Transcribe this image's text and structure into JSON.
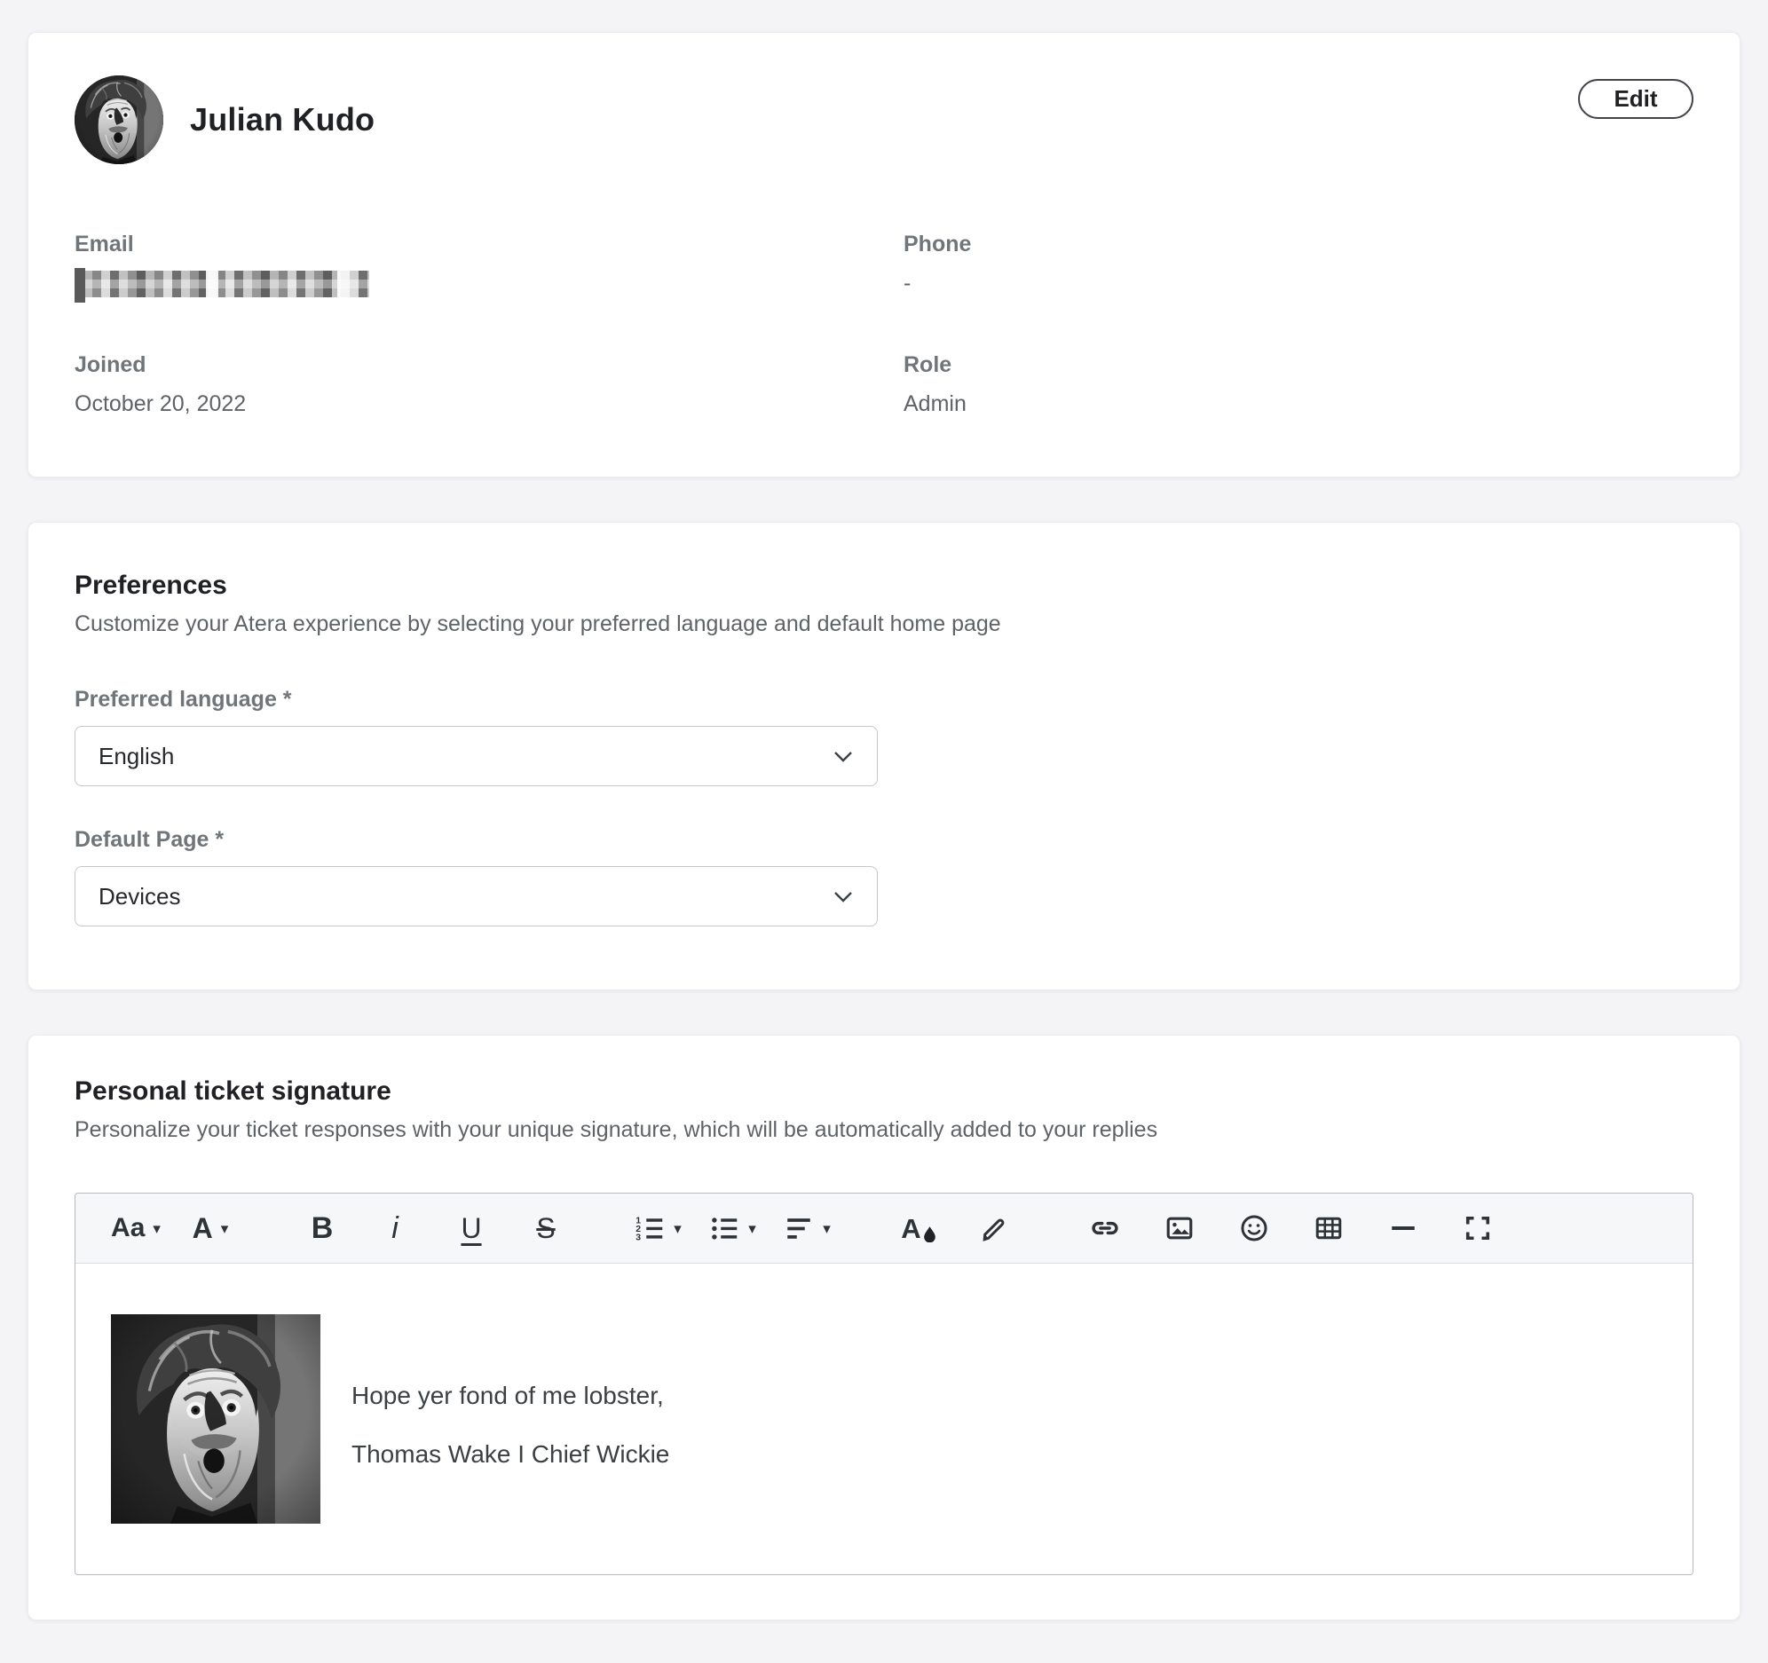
{
  "profile": {
    "name": "Julian Kudo",
    "edit_label": "Edit",
    "fields": [
      {
        "label": "Email",
        "value": "",
        "redacted": true
      },
      {
        "label": "Phone",
        "value": "-"
      },
      {
        "label": "Joined",
        "value": "October 20, 2022"
      },
      {
        "label": "Role",
        "value": "Admin"
      }
    ]
  },
  "preferences": {
    "title": "Preferences",
    "description": "Customize your Atera experience by selecting your preferred language and default home page",
    "language_label": "Preferred language *",
    "language_value": "English",
    "default_page_label": "Default Page *",
    "default_page_value": "Devices"
  },
  "signature": {
    "title": "Personal ticket signature",
    "description": "Personalize your ticket responses with your unique signature, which will be automatically added to your replies",
    "toolbar": {
      "font_size_glyph": "Aa",
      "font_family_glyph": "A",
      "bold_glyph": "B",
      "italic_glyph": "i",
      "underline_glyph": "U",
      "strikethrough_glyph": "S",
      "text_color_glyph": "A",
      "caret_glyph": "▾"
    },
    "content": {
      "line1": "Hope yer fond of me lobster,",
      "line2": "Thomas Wake I Chief Wickie"
    }
  },
  "colors": {
    "page_bg": "#f4f4f6",
    "card_bg": "#ffffff",
    "text_primary": "#202124",
    "text_secondary": "#5f6368",
    "toolbar_bg": "#f6f7f8"
  }
}
